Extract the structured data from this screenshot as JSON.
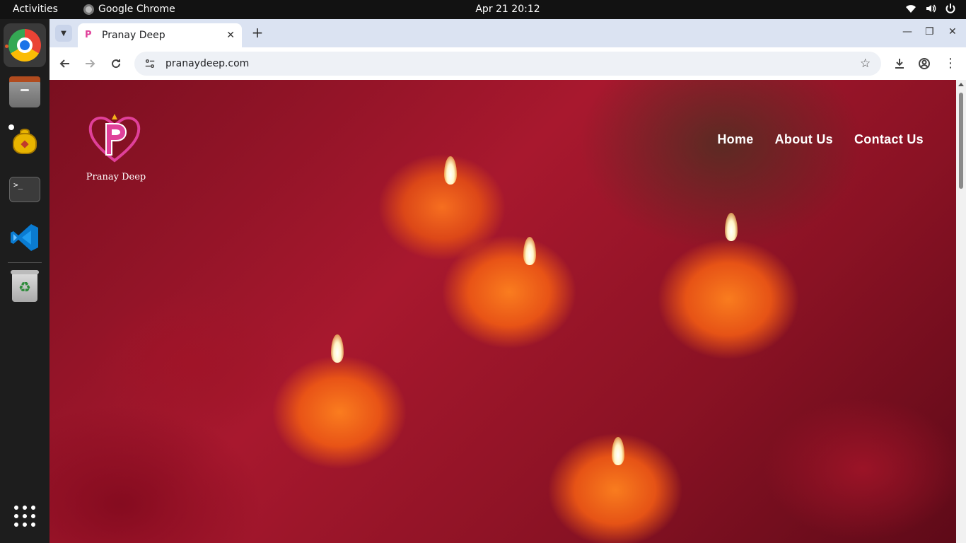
{
  "topbar": {
    "activities": "Activities",
    "app_name": "Google Chrome",
    "clock": "Apr 21  20:12",
    "tray_icons": [
      "wifi-icon",
      "volume-icon",
      "power-icon"
    ]
  },
  "dock": {
    "items": [
      {
        "name": "Google Chrome",
        "icon": "chrome-icon",
        "active": true
      },
      {
        "name": "Files",
        "icon": "files-icon"
      },
      {
        "name": "Teapot App",
        "icon": "teapot-icon"
      },
      {
        "name": "Terminal",
        "icon": "terminal-icon",
        "glyph": ">_"
      },
      {
        "name": "Visual Studio Code",
        "icon": "vscode-icon"
      },
      {
        "name": "Trash",
        "icon": "trash-icon",
        "glyph": "♻"
      }
    ],
    "apps_grid_icon": "app-grid-icon"
  },
  "browser": {
    "tab": {
      "title": "Pranay Deep",
      "favicon": "P",
      "close": "✕"
    },
    "new_tab": "+",
    "window_controls": {
      "minimize": "—",
      "maximize": "❐",
      "close": "✕"
    },
    "url": "pranaydeep.com",
    "accent": "#dbe3f2"
  },
  "site": {
    "logo_text": "Pranay Deep",
    "logo_letter": "P",
    "brand_color": "#e0409a",
    "nav": [
      "Home",
      "About Us",
      "Contact Us"
    ]
  }
}
